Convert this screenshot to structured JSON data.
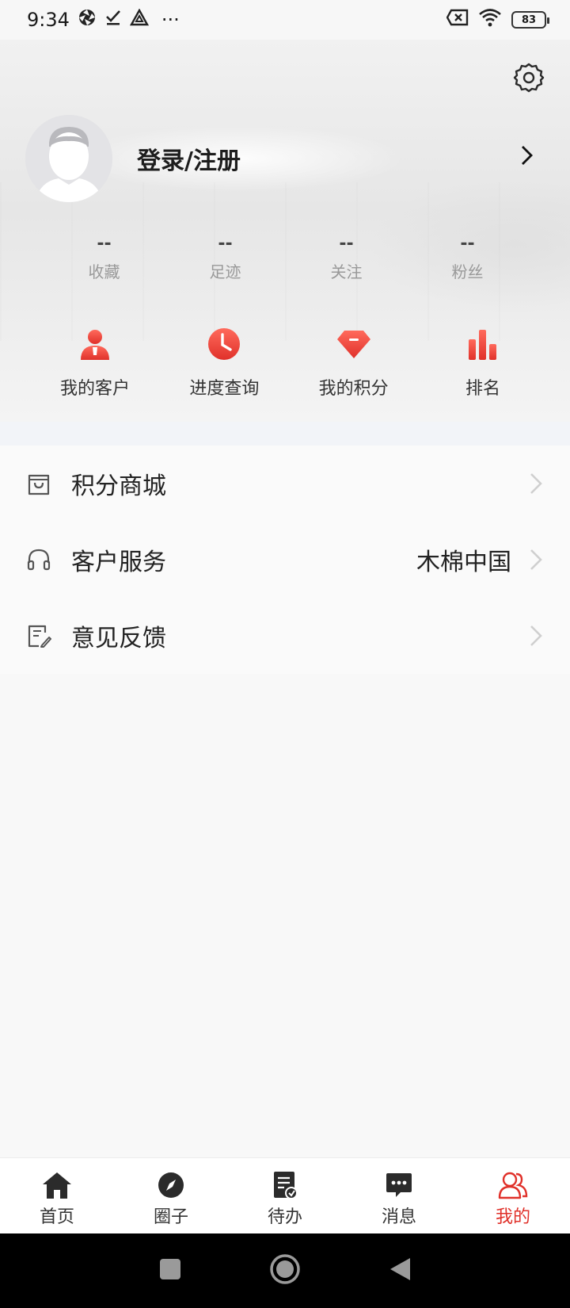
{
  "status_bar": {
    "time": "9:34",
    "more": "···",
    "battery": "83"
  },
  "profile": {
    "login_title": "登录/注册"
  },
  "stats": [
    {
      "value": "--",
      "label": "收藏"
    },
    {
      "value": "--",
      "label": "足迹"
    },
    {
      "value": "--",
      "label": "关注"
    },
    {
      "value": "--",
      "label": "粉丝"
    }
  ],
  "quick_actions": [
    {
      "label": "我的客户",
      "icon": "customer-icon"
    },
    {
      "label": "进度查询",
      "icon": "clock-icon"
    },
    {
      "label": "我的积分",
      "icon": "diamond-icon"
    },
    {
      "label": "排名",
      "icon": "bar-chart-icon"
    }
  ],
  "menu": [
    {
      "label": "积分商城",
      "value": "",
      "icon": "shopping-bag-icon"
    },
    {
      "label": "客户服务",
      "value": "木棉中国",
      "icon": "headset-icon"
    },
    {
      "label": "意见反馈",
      "value": "",
      "icon": "feedback-edit-icon"
    }
  ],
  "tabbar": [
    {
      "label": "首页",
      "icon": "home-icon"
    },
    {
      "label": "圈子",
      "icon": "compass-icon"
    },
    {
      "label": "待办",
      "icon": "todo-icon"
    },
    {
      "label": "消息",
      "icon": "message-icon"
    },
    {
      "label": "我的",
      "icon": "user-icon",
      "active": true
    }
  ],
  "colors": {
    "accent": "#e0312a",
    "text": "#222222",
    "muted": "#999999"
  }
}
